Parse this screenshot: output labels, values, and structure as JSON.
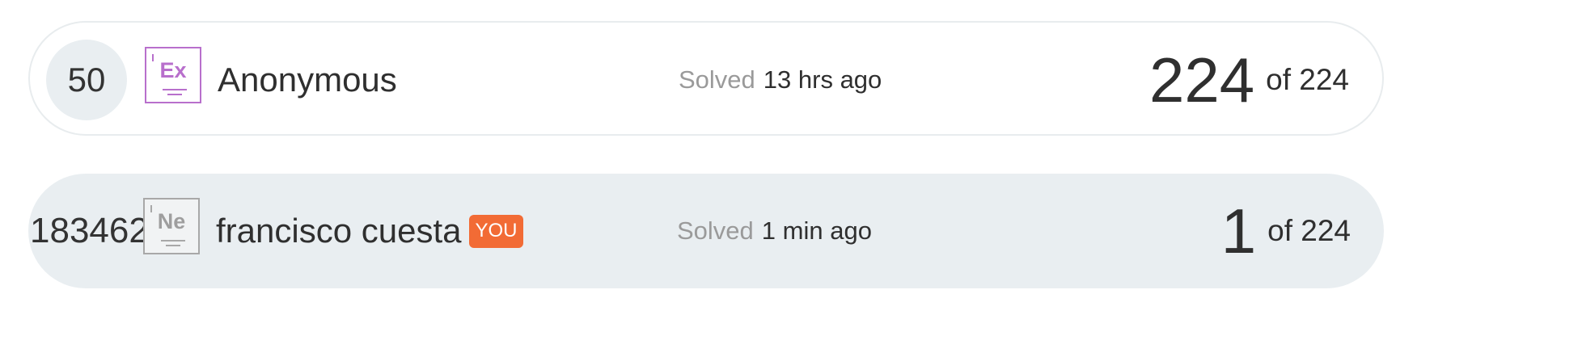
{
  "leaderboard": {
    "rows": [
      {
        "rank": "50",
        "badge_symbol": "Ex",
        "name": "Anonymous",
        "you_label": "",
        "solved_label": "Solved",
        "solved_time": "13 hrs ago",
        "score": "224",
        "score_total": "of 224",
        "badge_color": "#b86fcc"
      },
      {
        "rank": "183462",
        "badge_symbol": "Ne",
        "name": "francisco cuesta",
        "you_label": "YOU",
        "solved_label": "Solved",
        "solved_time": "1 min ago",
        "score": "1",
        "score_total": "of 224",
        "badge_color": "#a8a8a8",
        "highlight_color": "#e9eef1",
        "you_badge_color": "#f26b35"
      }
    ]
  }
}
